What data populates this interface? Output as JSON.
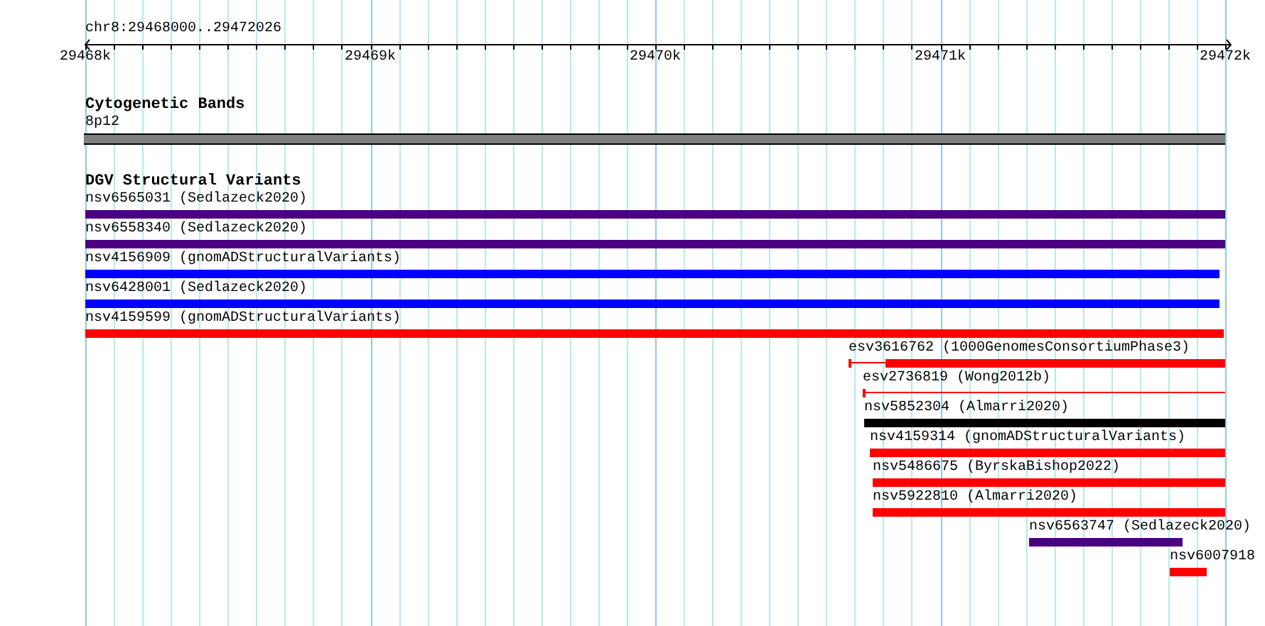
{
  "locus": "chr8:29468000..29472026",
  "ruler": {
    "ticks": [
      "29468k",
      "29469k",
      "29470k",
      "29471k",
      "29472k"
    ]
  },
  "tracks": [
    {
      "title": "Cytogenetic Bands",
      "features": [
        {
          "label": "8p12",
          "kind": "band",
          "color": "#808080"
        }
      ]
    },
    {
      "title": "DGV Structural Variants",
      "features": [
        {
          "label": "nsv6565031 (Sedlazeck2020)",
          "kind": "solid",
          "color": "#4b0082"
        },
        {
          "label": "nsv6558340 (Sedlazeck2020)",
          "kind": "solid",
          "color": "#4b0082"
        },
        {
          "label": "nsv4156909 (gnomADStructuralVariants)",
          "kind": "solid",
          "color": "#0000ff"
        },
        {
          "label": "nsv6428001 (Sedlazeck2020)",
          "kind": "solid",
          "color": "#0000ff"
        },
        {
          "label": "nsv4159599 (gnomADStructuralVariants)",
          "kind": "solid",
          "color": "#ff0000"
        },
        {
          "label": "esv3616762 (1000GenomesConsortiumPhase3)",
          "kind": "partial",
          "color": "#ff0000"
        },
        {
          "label": "esv2736819 (Wong2012b)",
          "kind": "thin",
          "color": "#ff0000"
        },
        {
          "label": "nsv5852304 (Almarri2020)",
          "kind": "solid",
          "color": "#000000"
        },
        {
          "label": "nsv4159314 (gnomADStructuralVariants)",
          "kind": "solid",
          "color": "#ff0000"
        },
        {
          "label": "nsv5486675 (ByrskaBishop2022)",
          "kind": "solid",
          "color": "#ff0000"
        },
        {
          "label": "nsv5922810 (Almarri2020)",
          "kind": "solid",
          "color": "#ff0000"
        },
        {
          "label": "nsv6563747 (Sedlazeck2020)",
          "kind": "solid",
          "color": "#4b0082"
        },
        {
          "label": "nsv6007918",
          "kind": "solid",
          "color": "#ff0000"
        }
      ]
    }
  ]
}
